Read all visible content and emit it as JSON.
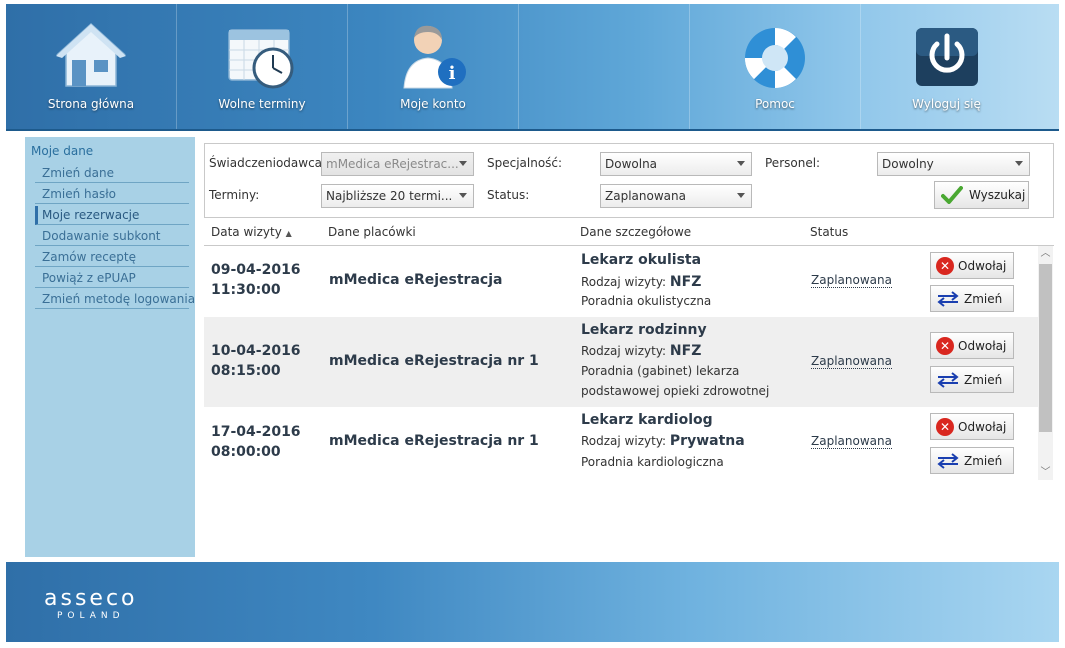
{
  "nav": {
    "home": "Strona główna",
    "free_slots": "Wolne terminy",
    "account": "Moje konto",
    "help": "Pomoc",
    "logout": "Wyloguj się"
  },
  "sidebar": {
    "title": "Moje dane",
    "items": [
      {
        "label": "Zmień dane"
      },
      {
        "label": "Zmień hasło"
      },
      {
        "label": "Moje rezerwacje"
      },
      {
        "label": "Dodawanie subkont"
      },
      {
        "label": "Zamów receptę"
      },
      {
        "label": "Powiąż z ePUAP"
      },
      {
        "label": "Zmień metodę logowania"
      }
    ]
  },
  "filters": {
    "provider_label": "Świadczeniodawca:",
    "provider_value": "mMedica eRejestrac...",
    "specialty_label": "Specjalność:",
    "specialty_value": "Dowolna",
    "staff_label": "Personel:",
    "staff_value": "Dowolny",
    "terms_label": "Terminy:",
    "terms_value": "Najbliższe 20 termi...",
    "status_label": "Status:",
    "status_value": "Zaplanowana",
    "search_label": "Wyszukaj"
  },
  "table": {
    "headers": {
      "date": "Data wizyty",
      "sort_indicator": "▲",
      "place": "Dane placówki",
      "details": "Dane szczegółowe",
      "status": "Status"
    },
    "visit_type_label": "Rodzaj wizyty:",
    "cancel_label": "Odwołaj",
    "change_label": "Zmień",
    "rows": [
      {
        "date": "09-04-2016",
        "time": "11:30:00",
        "place": "mMedica eRejestracja",
        "title": "Lekarz okulista",
        "visit_type": "NFZ",
        "clinic_line1": "Poradnia okulistyczna",
        "clinic_line2": "",
        "status": "Zaplanowana"
      },
      {
        "date": "10-04-2016",
        "time": "08:15:00",
        "place": "mMedica eRejestracja nr 1",
        "title": "Lekarz rodzinny",
        "visit_type": "NFZ",
        "clinic_line1": "Poradnia (gabinet) lekarza",
        "clinic_line2": "podstawowej opieki zdrowotnej",
        "status": "Zaplanowana"
      },
      {
        "date": "17-04-2016",
        "time": "08:00:00",
        "place": "mMedica eRejestracja nr 1",
        "title": "Lekarz kardiolog",
        "visit_type": "Prywatna",
        "clinic_line1": "Poradnia kardiologiczna",
        "clinic_line2": "",
        "status": "Zaplanowana"
      }
    ]
  },
  "footer": {
    "logo_main": "asseco",
    "logo_sub": "POLAND"
  }
}
